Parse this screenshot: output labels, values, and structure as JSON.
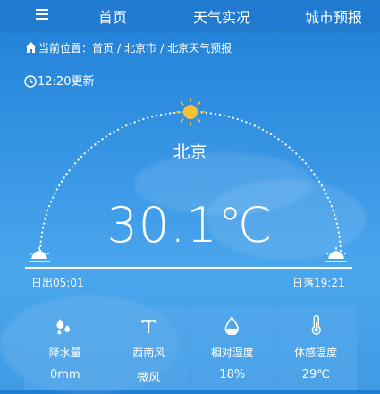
{
  "nav": {
    "items": [
      {
        "label": "首页"
      },
      {
        "label": "天气实况"
      },
      {
        "label": "城市预报"
      }
    ]
  },
  "breadcrumb": {
    "prefix": "当前位置：",
    "items": [
      "首页",
      "北京市",
      "北京天气预报"
    ]
  },
  "update": {
    "text": "12:20更新"
  },
  "weather": {
    "city": "北京",
    "temperature": "30.1℃",
    "sunrise": "日出05:01",
    "sunset": "日落19:21"
  },
  "cards": [
    {
      "icon": "raindrops-icon",
      "label": "降水量",
      "value": "0mm"
    },
    {
      "icon": "wind-vane-icon",
      "label": "西南风",
      "value": "微风"
    },
    {
      "icon": "humidity-drop-icon",
      "label": "相对湿度",
      "value": "18%"
    },
    {
      "icon": "thermometer-icon",
      "label": "体感温度",
      "value": "29℃"
    }
  ],
  "colors": {
    "sun": "#f5c12e",
    "nav_bg": "#1f7ad0"
  }
}
